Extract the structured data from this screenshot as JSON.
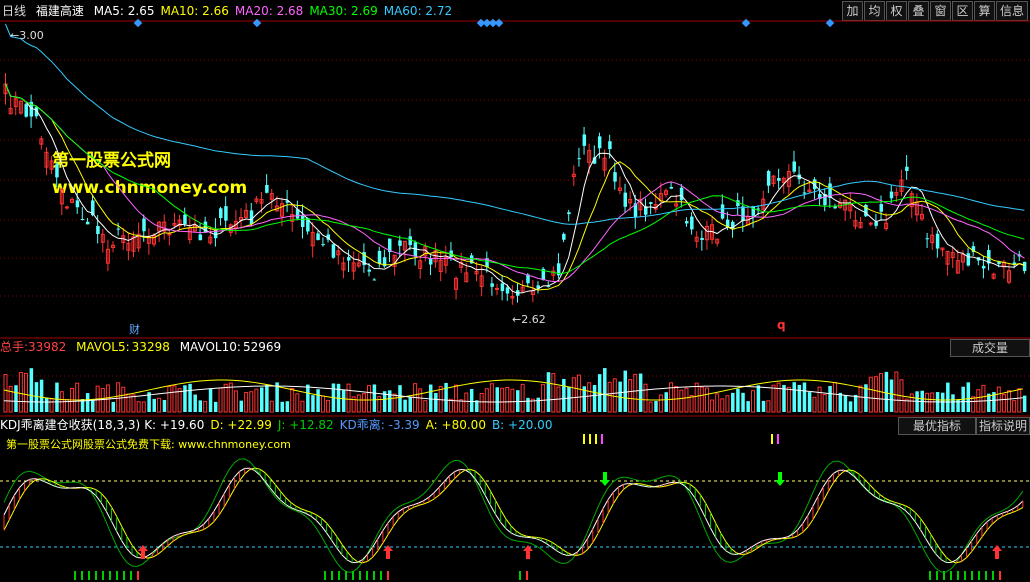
{
  "header": {
    "period": "日线",
    "stock_name": "福建高速",
    "ma_items": [
      {
        "label": "MA5:",
        "value": "2.65",
        "color": "#ffffff"
      },
      {
        "label": "MA10:",
        "value": "2.66",
        "color": "#ffff00"
      },
      {
        "label": "MA20:",
        "value": "2.68",
        "color": "#ff66ff"
      },
      {
        "label": "MA30:",
        "value": "2.69",
        "color": "#00ff00"
      },
      {
        "label": "MA60:",
        "value": "2.72",
        "color": "#33ccff"
      }
    ]
  },
  "toolbar": {
    "buttons": [
      "加",
      "均",
      "权",
      "叠",
      "窗",
      "区",
      "算",
      "信息"
    ]
  },
  "price_panel": {
    "high_label": "3.00",
    "low_label": "2.62",
    "marker_cai": "财",
    "marker_q": "q",
    "watermark_title": "第一股票公式网",
    "watermark_url": "www.chnmoney.com"
  },
  "volume_panel": {
    "total_label": "总手:",
    "total_value": "33982",
    "mavol5_label": "MAVOL5:",
    "mavol5_value": "33298",
    "mavol10_label": "MAVOL10:",
    "mavol10_value": "52969",
    "button_label": "成交量"
  },
  "indicator_panel": {
    "name": "KDJ乖离建仓收获(18,3,3)",
    "values": [
      {
        "label": "K:",
        "value": "+19.60",
        "color": "#ffffff"
      },
      {
        "label": "D:",
        "value": "+22.99",
        "color": "#ffff00"
      },
      {
        "label": "J:",
        "value": "+12.82",
        "color": "#00cc00"
      },
      {
        "label": "KD乖离:",
        "value": "-3.39",
        "color": "#5599ff"
      },
      {
        "label": "A:",
        "value": "+80.00",
        "color": "#ffff00"
      },
      {
        "label": "B:",
        "value": "+20.00",
        "color": "#33ccff"
      }
    ],
    "promo_text": "第一股票公式网股票公式免费下载: www.chnmoney.com",
    "best_button": "最优指标",
    "help_button": "指标说明"
  },
  "colors": {
    "up": "#ff3333",
    "down": "#55ffff",
    "ma5": "#ffffff",
    "ma10": "#ffff00",
    "ma20": "#ff66ff",
    "ma30": "#00ff00",
    "ma60": "#33ccff",
    "grid": "#800000"
  }
}
